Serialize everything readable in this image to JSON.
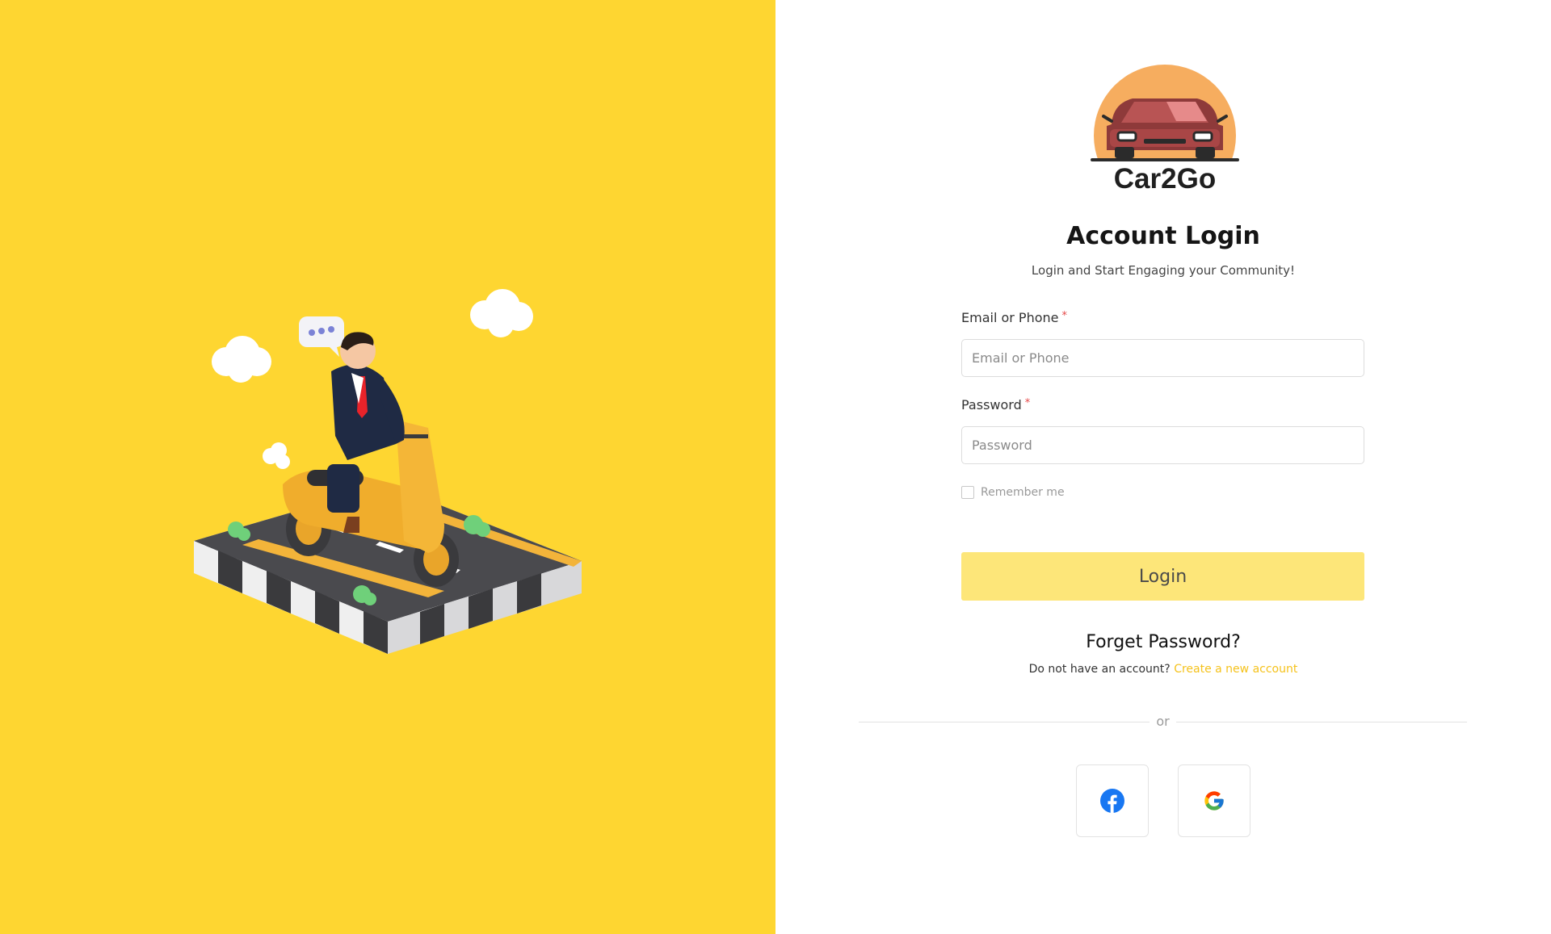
{
  "brand": {
    "name": "Car2Go"
  },
  "login": {
    "title": "Account Login",
    "subtitle": "Login and Start Engaging your Community!",
    "email_label": "Email or Phone",
    "email_placeholder": "Email or Phone",
    "password_label": "Password",
    "password_placeholder": "Password",
    "required_marker": "*",
    "remember_label": "Remember me",
    "submit_label": "Login",
    "forget_label": "Forget Password?",
    "no_account_text": "Do not have an account?",
    "create_account_label": "Create a new account",
    "divider_text": "or"
  },
  "social": [
    {
      "icon": "facebook-icon",
      "color": "#1877f2"
    },
    {
      "icon": "google-icon"
    }
  ],
  "colors": {
    "left_panel": "#fed631",
    "accent": "#f5c21b",
    "login_button": "#fde679"
  }
}
